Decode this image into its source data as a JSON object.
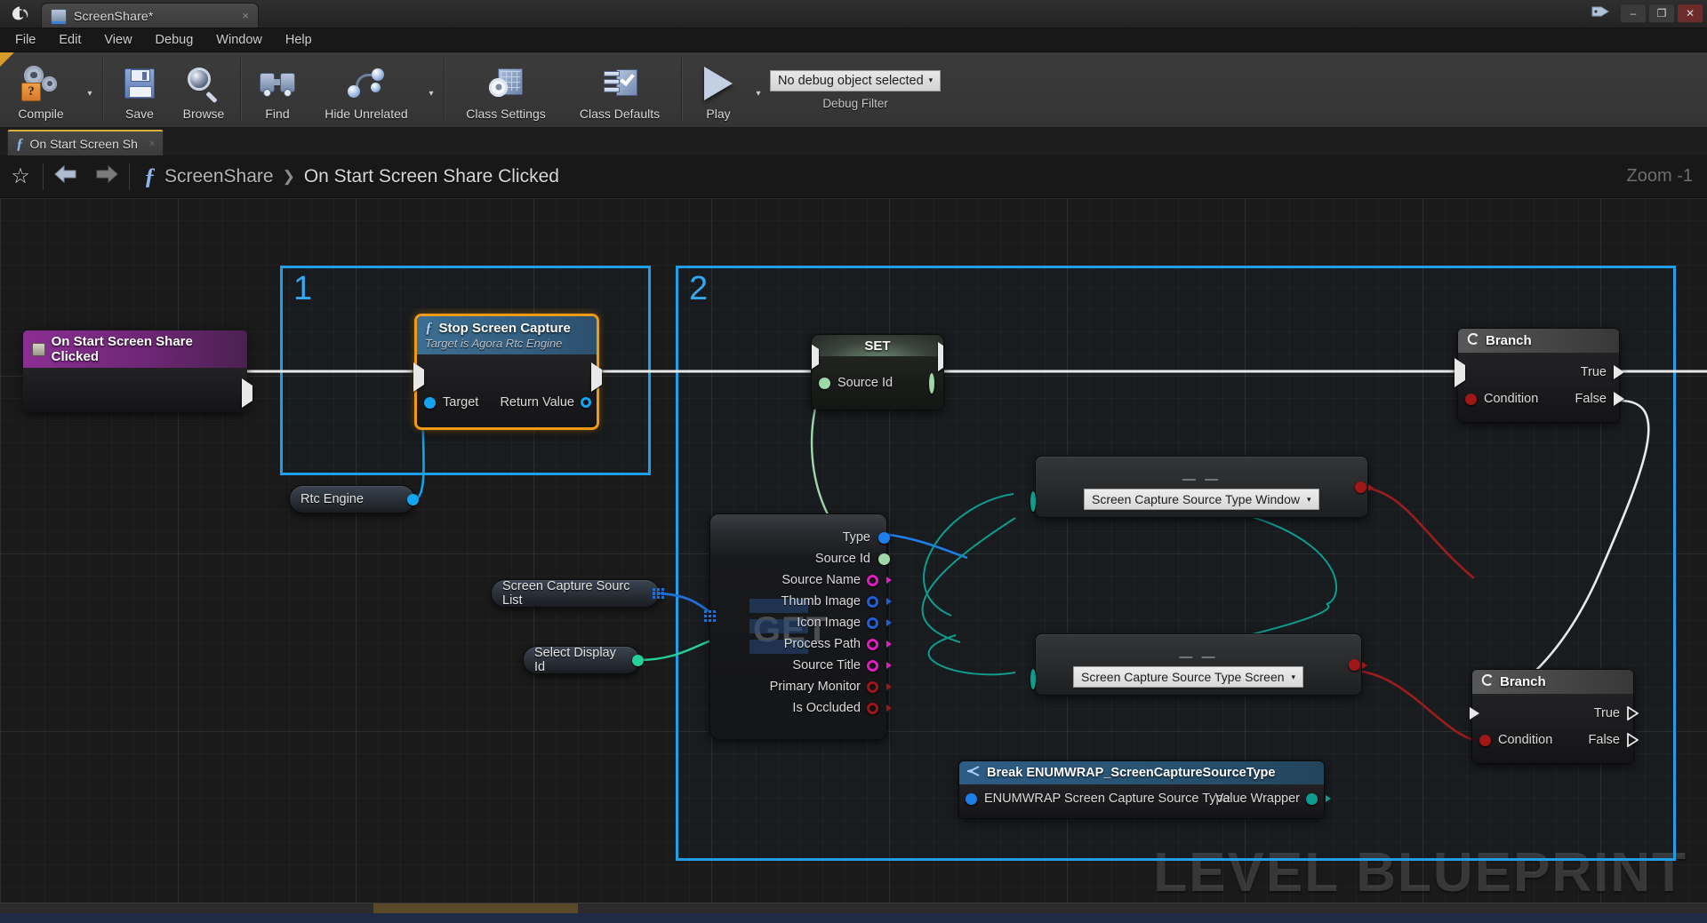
{
  "window": {
    "title": "ScreenShare*",
    "logo": "unreal-logo",
    "tab_icon": "blueprint-icon",
    "close_glyph": "×",
    "tag_glyph": "🏷",
    "buttons": {
      "minimize": "–",
      "maximize": "❐",
      "close": "✕"
    }
  },
  "menu": {
    "items": [
      "File",
      "Edit",
      "View",
      "Debug",
      "Window",
      "Help"
    ]
  },
  "toolbar": {
    "compile": {
      "label": "Compile",
      "icon": "gears-question-icon",
      "caret": "▾"
    },
    "save": {
      "label": "Save",
      "icon": "floppy-disk-icon"
    },
    "browse": {
      "label": "Browse",
      "icon": "magnifier-icon"
    },
    "find": {
      "label": "Find",
      "icon": "binoculars-icon"
    },
    "hide_unrelated": {
      "label": "Hide Unrelated",
      "icon": "nodes-wire-icon",
      "caret": "▾"
    },
    "class_settings": {
      "label": "Class Settings",
      "icon": "gear-page-icon"
    },
    "class_defaults": {
      "label": "Class Defaults",
      "icon": "checklist-icon"
    },
    "play": {
      "label": "Play",
      "icon": "play-triangle-icon",
      "caret": "▾"
    },
    "debug_object": {
      "value": "No debug object selected",
      "caret": "▾"
    },
    "debug_filter_caption": "Debug Filter"
  },
  "function_tab": {
    "label": "On Start Screen Sh",
    "fx_glyph": "ƒ",
    "close_glyph": "×"
  },
  "breadcrumb": {
    "favorite_glyph": "☆",
    "back_glyph": "➤",
    "forward_glyph": "➤",
    "fx_glyph": "ƒ",
    "segments": [
      "ScreenShare",
      "On Start Screen Share Clicked"
    ],
    "separator": "❯",
    "zoom_label": "Zoom -1"
  },
  "graph": {
    "watermark": "LEVEL BLUEPRINT",
    "comment_boxes": [
      {
        "number": "1"
      },
      {
        "number": "2"
      }
    ],
    "nodes": {
      "event": {
        "title": "On Start Screen Share Clicked",
        "icon": "event-node-icon",
        "header_color": "#8a2f93"
      },
      "stop_screen_capture": {
        "title": "Stop Screen Capture",
        "subtitle": "Target is Agora Rtc Engine",
        "fx_glyph": "ƒ",
        "input_pin": "Target",
        "output_pin": "Return Value",
        "selected_color": "#f09a16"
      },
      "rtc_engine": {
        "label": "Rtc Engine"
      },
      "set_node": {
        "title": "SET",
        "input_pin": "Source Id",
        "output_pin": ""
      },
      "screen_capture_source_list": {
        "label": "Screen Capture Sourc List"
      },
      "select_display_id": {
        "label": "Select Display Id"
      },
      "get_node": {
        "watermark": "GET",
        "pins": [
          {
            "label": "Type",
            "color": "#1f7fe8",
            "style": "filled"
          },
          {
            "label": "Source Id",
            "color": "#9fd8a8",
            "style": "filled"
          },
          {
            "label": "Source Name",
            "color": "#e01ec0",
            "style": "hollow"
          },
          {
            "label": "Thumb Image",
            "color": "#1f5fd8",
            "style": "hollow"
          },
          {
            "label": "Icon Image",
            "color": "#1f5fd8",
            "style": "hollow"
          },
          {
            "label": "Process Path",
            "color": "#e01ec0",
            "style": "hollow"
          },
          {
            "label": "Source Title",
            "color": "#e01ec0",
            "style": "hollow"
          },
          {
            "label": "Primary Monitor",
            "color": "#a01717",
            "style": "hollow"
          },
          {
            "label": "Is Occluded",
            "color": "#a01717",
            "style": "hollow"
          }
        ]
      },
      "break_enumwrap": {
        "title": "Break ENUMWRAP_ScreenCaptureSourceType",
        "icon": "break-struct-icon",
        "input_pin": "ENUMWRAP Screen Capture Source Type",
        "output_pin": "Value Wrapper"
      },
      "equal_window": {
        "value": "Screen Capture Source Type Window",
        "caret": "▾",
        "dashes": "— —"
      },
      "equal_screen": {
        "value": "Screen Capture Source Type Screen",
        "caret": "▾",
        "dashes": "— —"
      },
      "branch_top": {
        "title": "Branch",
        "icon": "branch-icon",
        "condition_pin": "Condition",
        "true_pin": "True",
        "false_pin": "False"
      },
      "branch_bottom": {
        "title": "Branch",
        "icon": "branch-icon",
        "condition_pin": "Condition",
        "true_pin": "True",
        "false_pin": "False"
      }
    }
  },
  "colors": {
    "comment_blue": "#1f9fe8",
    "exec_white": "#e8e8e8",
    "object_blue": "#1f9fe8",
    "string_magenta": "#e01ec0",
    "bool_red": "#a01717",
    "struct_teal": "#0f9b8e",
    "int_green": "#2fd8a0",
    "event_purple": "#8a2f93"
  }
}
